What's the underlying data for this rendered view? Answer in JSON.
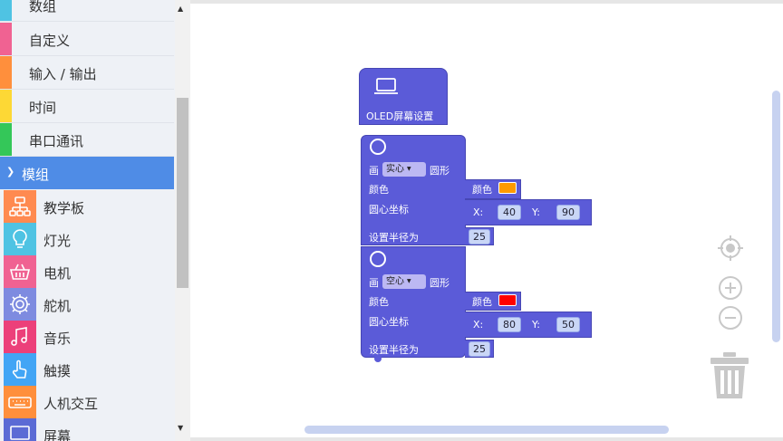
{
  "sidebar": {
    "categories": [
      {
        "label": "数组",
        "color": "#4fc3e3"
      },
      {
        "label": "自定义",
        "color": "#f06292"
      },
      {
        "label": "输入 / 输出",
        "color": "#ff8f3c"
      },
      {
        "label": "时间",
        "color": "#fdd835"
      },
      {
        "label": "串口通讯",
        "color": "#34c759"
      }
    ],
    "module_header": "模组",
    "modules": [
      {
        "label": "教学板",
        "icon": "network-board-icon",
        "color": "#ff8a50"
      },
      {
        "label": "灯光",
        "icon": "light-bulb-icon",
        "color": "#4fc3e3"
      },
      {
        "label": "电机",
        "icon": "motor-basket-icon",
        "color": "#f06292"
      },
      {
        "label": "舵机",
        "icon": "servo-gear-icon",
        "color": "#7e8be0"
      },
      {
        "label": "音乐",
        "icon": "music-note-icon",
        "color": "#ec407a"
      },
      {
        "label": "触摸",
        "icon": "touch-hand-icon",
        "color": "#42a5f5"
      },
      {
        "label": "人机交互",
        "icon": "keyboard-icon",
        "color": "#ff8f3c"
      },
      {
        "label": "屏幕",
        "icon": "screen-icon",
        "color": "#5b6bd5"
      }
    ]
  },
  "blocks": {
    "oled_label": "OLED屏幕设置",
    "circle1": {
      "draw": "画",
      "mode": "实心",
      "shape": "圆形",
      "color_label": "颜色",
      "color_value_label": "颜色",
      "color": "#ff9a00",
      "center_label": "圆心坐标",
      "x_label": "X:",
      "x": "40",
      "y_label": "Y:",
      "y": "90",
      "radius_label": "设置半径为",
      "radius": "25"
    },
    "circle2": {
      "draw": "画",
      "mode": "空心",
      "shape": "圆形",
      "color_label": "颜色",
      "color_value_label": "颜色",
      "color": "#ff0000",
      "center_label": "圆心坐标",
      "x_label": "X:",
      "x": "80",
      "y_label": "Y:",
      "y": "50",
      "radius_label": "设置半径为",
      "radius": "25"
    }
  },
  "colors": {
    "block": "#5b5bd8",
    "accent": "#4f8ce6"
  }
}
